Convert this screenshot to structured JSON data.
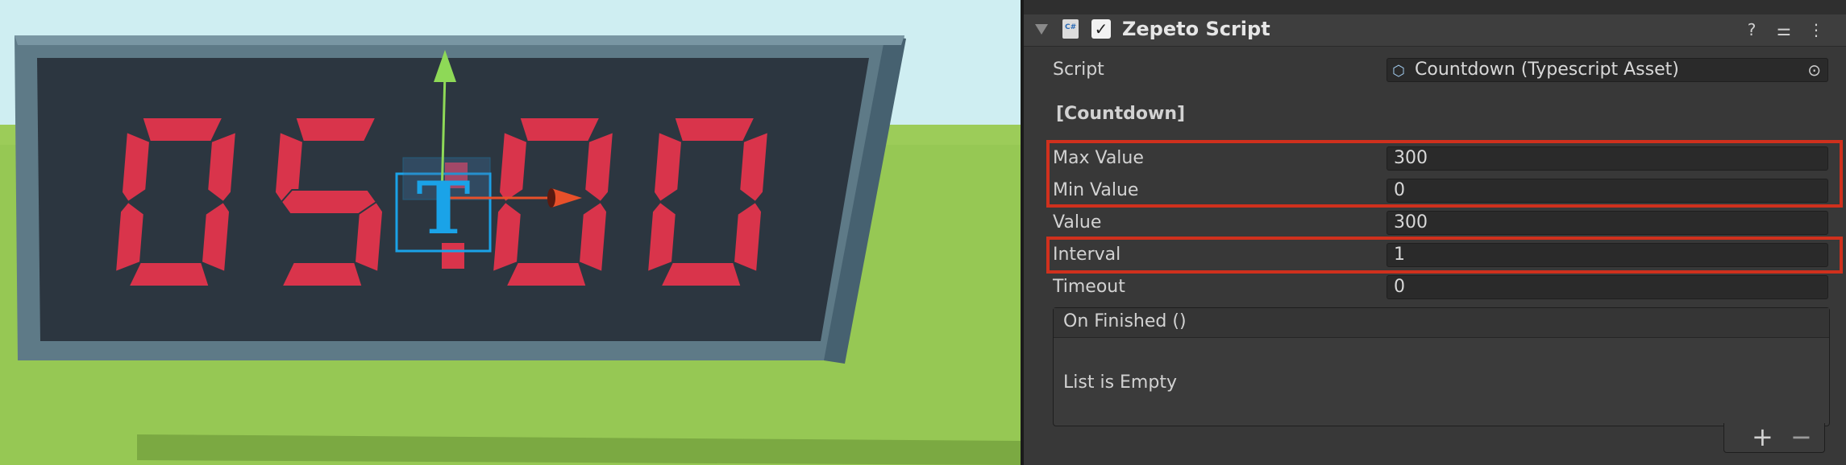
{
  "scene": {
    "display_text": "05:00",
    "gizmo_letter": "T",
    "colors": {
      "sky": "#cfeef2",
      "grass": "#9ccc59",
      "frame": "#5e7a87",
      "panel": "#2c3640",
      "digit": "#d9344b"
    }
  },
  "inspector": {
    "component_title": "Zepeto Script",
    "enabled": true,
    "icons": {
      "collapse": "triangle-down-icon",
      "script": "csharp-script-icon",
      "help": "help-icon",
      "settings": "sliders-icon",
      "menu": "kebab-menu-icon"
    },
    "script_row": {
      "label": "Script",
      "value": "Countdown (Typescript Asset)"
    },
    "section_title": "[Countdown]",
    "fields": [
      {
        "label": "Max Value",
        "value": "300"
      },
      {
        "label": "Min Value",
        "value": "0"
      },
      {
        "label": "Value",
        "value": "300"
      },
      {
        "label": "Interval",
        "value": "1"
      },
      {
        "label": "Timeout",
        "value": "0"
      }
    ],
    "event": {
      "title": "On Finished ()",
      "empty_text": "List is Empty",
      "add": "+",
      "remove": "−"
    },
    "highlight_color": "#d0301d"
  }
}
